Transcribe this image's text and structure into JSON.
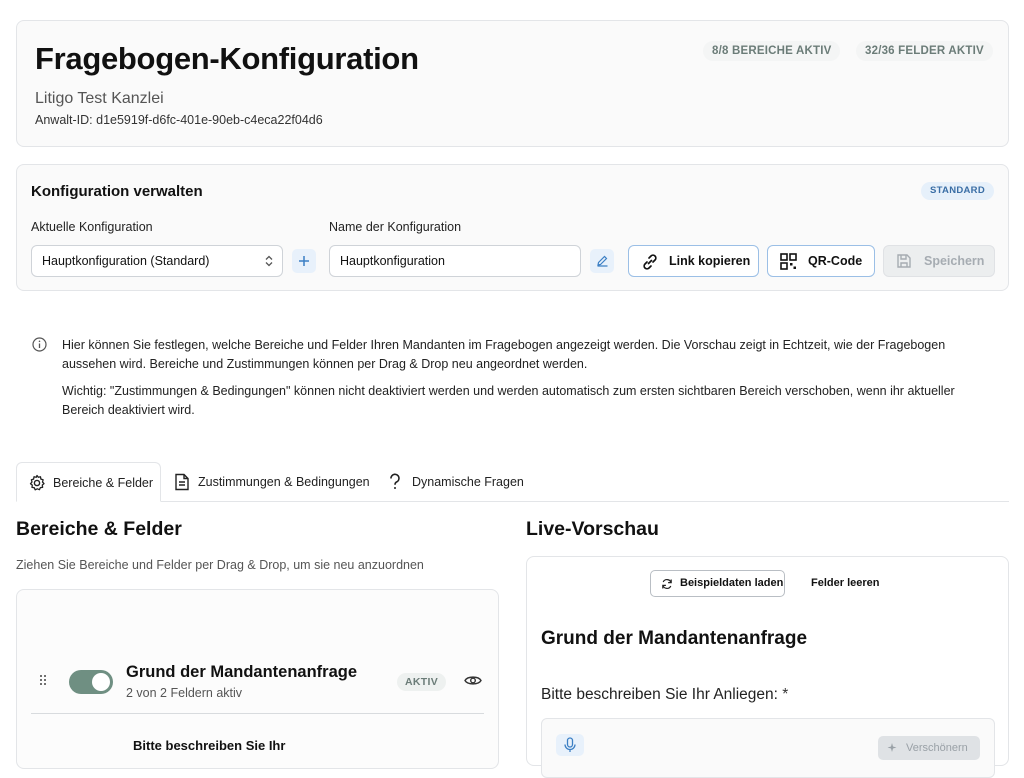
{
  "header": {
    "title": "Fragebogen-Konfiguration",
    "subtitle": "Litigo Test Kanzlei",
    "lawyer_id": "Anwalt-ID: d1e5919f-d6fc-401e-90eb-c4eca22f04d6",
    "stat_sections": "8/8 BEREICHE AKTIV",
    "stat_fields": "32/36 FELDER AKTIV"
  },
  "config": {
    "title": "Konfiguration verwalten",
    "badge": "STANDARD",
    "current_label": "Aktuelle Konfiguration",
    "current_value": "Hauptkonfiguration (Standard)",
    "name_label": "Name der Konfiguration",
    "name_value": "Hauptkonfiguration",
    "copy_link": "Link kopieren",
    "qr_code": "QR-Code",
    "save": "Speichern"
  },
  "info": {
    "p1": "Hier können Sie festlegen, welche Bereiche und Felder Ihren Mandanten im Fragebogen angezeigt werden. Die Vorschau zeigt in Echtzeit, wie der Fragebogen aussehen wird. Bereiche und Zustimmungen können per Drag & Drop neu angeordnet werden.",
    "p2": "Wichtig: \"Zustimmungen & Bedingungen\" können nicht deaktiviert werden und werden automatisch zum ersten sichtbaren Bereich verschoben, wenn ihr aktueller Bereich deaktiviert wird."
  },
  "tabs": [
    {
      "label": "Bereiche & Felder",
      "icon": "gear-icon",
      "active": true
    },
    {
      "label": "Zustimmungen & Bedingungen",
      "icon": "document-icon",
      "active": false
    },
    {
      "label": "Dynamische Fragen",
      "icon": "question-icon",
      "active": false
    }
  ],
  "builder": {
    "title": "Bereiche & Felder",
    "hint": "Ziehen Sie Bereiche und Felder per Drag & Drop, um sie neu anzuordnen",
    "section_name": "Grund der Mandantenanfrage",
    "section_count": "2 von 2 Feldern aktiv",
    "section_status": "AKTIV",
    "section_enabled": true,
    "field_name": "Bitte beschreiben Sie Ihr"
  },
  "preview": {
    "title": "Live-Vorschau",
    "load_sample": "Beispieldaten laden",
    "clear_fields": "Felder leeren",
    "section_title": "Grund der Mandantenanfrage",
    "question": "Bitte beschreiben Sie Ihr Anliegen:",
    "required_marker": "*",
    "beautify": "Verschönern"
  },
  "colors": {
    "accent_blue": "#3b7fc4",
    "toggle_green": "#6f8f82",
    "badge_blue_bg": "#e6f0fa"
  }
}
